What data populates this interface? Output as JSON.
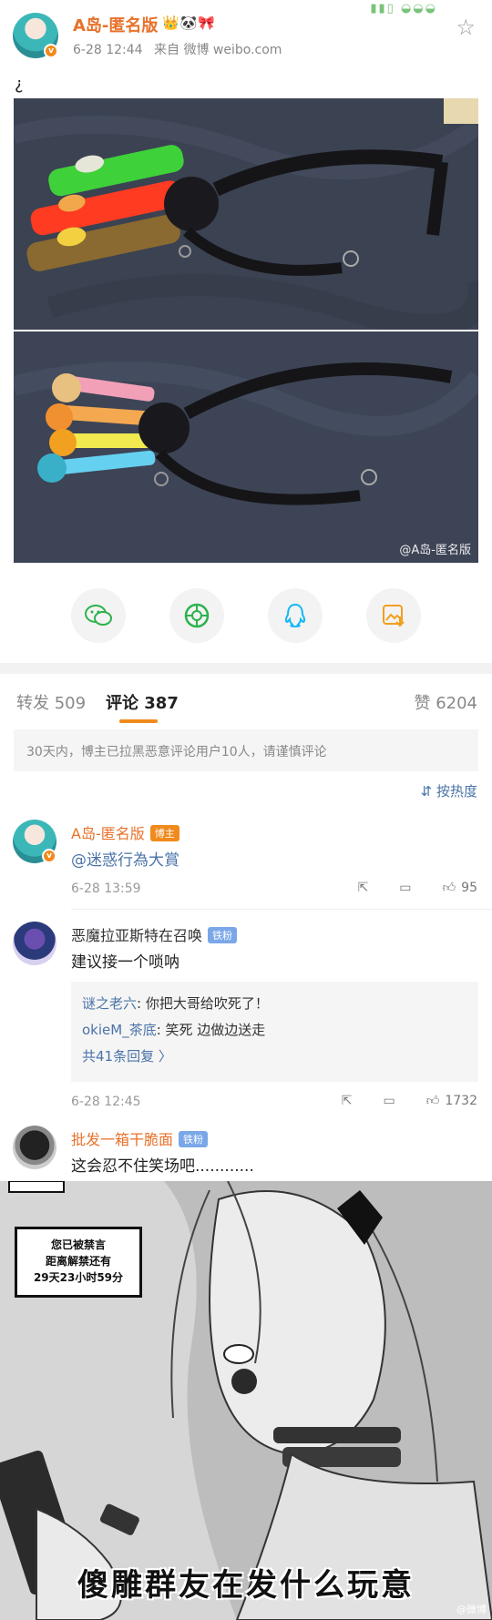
{
  "post": {
    "author": "A岛-匿名版",
    "author_badges": "👑🐼🎀",
    "verified_mark": "v",
    "time": "6-28 12:44",
    "source": "来自 微博 weibo.com",
    "text": "¿",
    "watermark": "@A岛-匿名版"
  },
  "share": {
    "wechat": "wechat-icon",
    "moments": "moments-icon",
    "qq": "qq-icon",
    "save": "save-image-icon"
  },
  "tabs": {
    "repost_label": "转发",
    "repost_count": "509",
    "comment_label": "评论",
    "comment_count": "387",
    "like_label": "赞",
    "like_count": "6204"
  },
  "notice": "30天内，博主已拉黑恶意评论用户10人，请谨慎评论",
  "sort_label": "按热度",
  "comments": [
    {
      "name": "A岛-匿名版",
      "tag": "博主",
      "text": "@迷惑行為大賞",
      "time": "6-28 13:59",
      "likes": "95"
    },
    {
      "name": "恶魔拉亚斯特在召唤",
      "tag": "铁粉",
      "text": "建议接一个唢呐",
      "time": "6-28 12:45",
      "likes": "1732",
      "replies": [
        {
          "name": "谜之老六",
          "text": ": 你把大哥给吹死了！"
        },
        {
          "name": "okieM_茶底",
          "text": ": 笑死 边做边送走"
        }
      ],
      "more": "共41条回复 〉"
    },
    {
      "name": "批发一箱干脆面",
      "tag": "铁粉",
      "text": "这会忍不住笑场吧............"
    }
  ],
  "meme": {
    "box_line1": "您已被禁言",
    "box_line2": "距离解禁还有",
    "box_line3": "29天23小时59分",
    "caption": "傻雕群友在发什么玩意",
    "watermark": "@微博"
  }
}
